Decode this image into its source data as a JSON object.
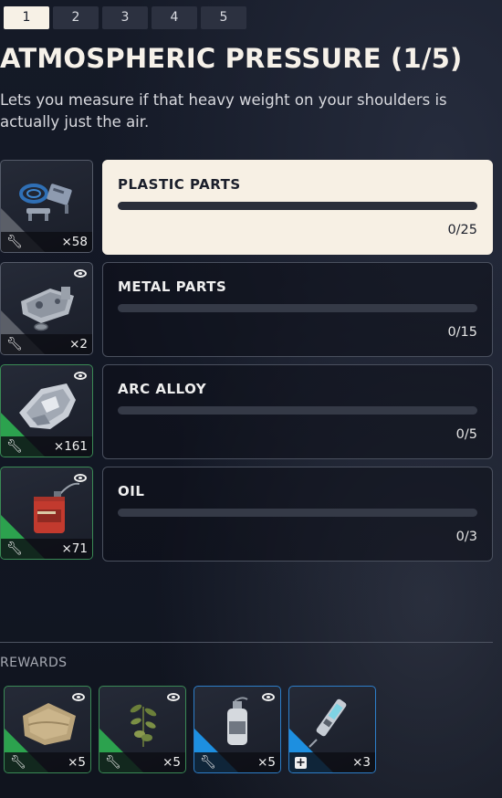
{
  "tabs": [
    "1",
    "2",
    "3",
    "4",
    "5"
  ],
  "active_tab": 0,
  "project": {
    "title": "ATMOSPHERIC PRESSURE (1/5)",
    "description": "Lets you measure if that heavy weight on your shoulders is actually just the air."
  },
  "requirements": [
    {
      "name": "PLASTIC PARTS",
      "progress": "0/25",
      "current": 0,
      "required": 25,
      "owned": "×58",
      "rarity": "common",
      "rarity_color": "#5b5f68",
      "tracked": false,
      "selected": true,
      "icon": "plastic-parts-icon"
    },
    {
      "name": "METAL PARTS",
      "progress": "0/15",
      "current": 0,
      "required": 15,
      "owned": "×2",
      "rarity": "common",
      "rarity_color": "#5b5f68",
      "tracked": true,
      "selected": false,
      "icon": "metal-parts-icon"
    },
    {
      "name": "ARC ALLOY",
      "progress": "0/5",
      "current": 0,
      "required": 5,
      "owned": "×161",
      "rarity": "uncommon",
      "rarity_color": "#2ca24e",
      "tracked": true,
      "selected": false,
      "icon": "arc-alloy-icon"
    },
    {
      "name": "OIL",
      "progress": "0/3",
      "current": 0,
      "required": 3,
      "owned": "×71",
      "rarity": "uncommon",
      "rarity_color": "#2ca24e",
      "tracked": true,
      "selected": false,
      "icon": "oil-can-icon"
    }
  ],
  "rewards_label": "REWARDS",
  "rewards": [
    {
      "icon": "cloth-icon",
      "count": "×5",
      "rarity": "uncommon",
      "rarity_color": "#2ca24e",
      "tracked": true,
      "type_icon": "wrench-icon"
    },
    {
      "icon": "plant-icon",
      "count": "×5",
      "rarity": "uncommon",
      "rarity_color": "#2ca24e",
      "tracked": true,
      "type_icon": "wrench-icon"
    },
    {
      "icon": "bottle-icon",
      "count": "×5",
      "rarity": "rare",
      "rarity_color": "#1d8fe0",
      "tracked": true,
      "type_icon": "wrench-icon"
    },
    {
      "icon": "syringe-icon",
      "count": "×3",
      "rarity": "rare",
      "rarity_color": "#1d8fe0",
      "tracked": false,
      "type_icon": "plus-icon"
    }
  ],
  "colors": {
    "accent": "#f7f1e6",
    "progress_fill": "#f0b429",
    "uncommon": "#2ca24e",
    "rare": "#1d8fe0",
    "common": "#5b5f68"
  }
}
